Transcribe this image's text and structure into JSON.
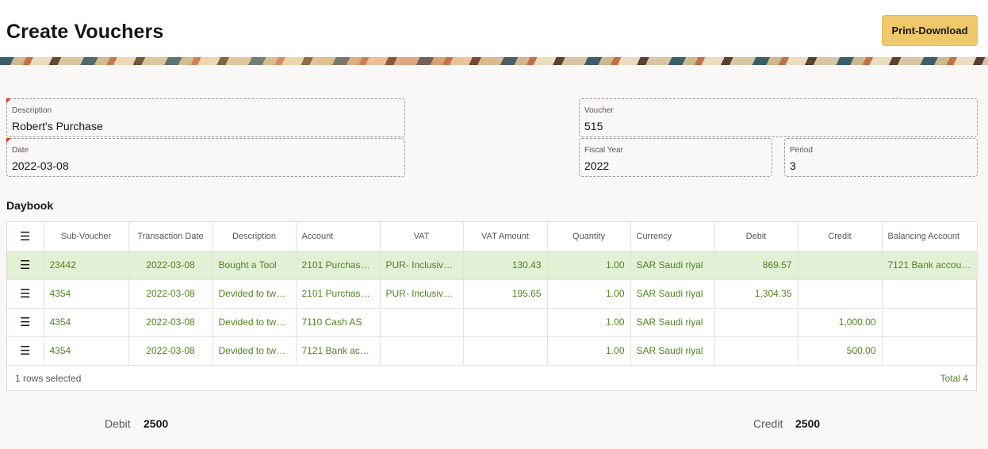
{
  "header": {
    "title": "Create Vouchers",
    "print_label": "Print-Download"
  },
  "form": {
    "description": {
      "label": "Description",
      "value": "Robert's Purchase"
    },
    "date": {
      "label": "Date",
      "value": "2022-03-08"
    },
    "voucher": {
      "label": "Voucher",
      "value": "515"
    },
    "fiscal_year": {
      "label": "Fiscal Year",
      "value": "2022"
    },
    "period": {
      "label": "Period",
      "value": "3"
    }
  },
  "daybook": {
    "title": "Daybook",
    "columns": [
      "Sub-Voucher",
      "Transaction Date",
      "Description",
      "Account",
      "VAT",
      "VAT Amount",
      "Quantity",
      "Currency",
      "Debit",
      "Credit",
      "Balancing Account"
    ],
    "rows": [
      {
        "sub_voucher": "23442",
        "date": "2022-03-08",
        "description": "Bought a Tool",
        "account": "2101 Purchase…",
        "vat": "PUR- Inclusiv…",
        "vat_amount": "130.43",
        "quantity": "1.00",
        "currency": "SAR Saudi riyal",
        "debit": "869.57",
        "credit": "",
        "balancing": "7121 Bank accou…",
        "selected": true
      },
      {
        "sub_voucher": "4354",
        "date": "2022-03-08",
        "description": "Devided to tw…",
        "account": "2101 Purchase…",
        "vat": "PUR- Inclusiv…",
        "vat_amount": "195.65",
        "quantity": "1.00",
        "currency": "SAR Saudi riyal",
        "debit": "1,304.35",
        "credit": "",
        "balancing": "",
        "selected": false
      },
      {
        "sub_voucher": "4354",
        "date": "2022-03-08",
        "description": "Devided to tw…",
        "account": "7110 Cash AS",
        "vat": "",
        "vat_amount": "",
        "quantity": "1.00",
        "currency": "SAR Saudi riyal",
        "debit": "",
        "credit": "1,000.00",
        "balancing": "",
        "selected": false
      },
      {
        "sub_voucher": "4354",
        "date": "2022-03-08",
        "description": "Devided to tw…",
        "account": "7121 Bank acc…",
        "vat": "",
        "vat_amount": "",
        "quantity": "1.00",
        "currency": "SAR Saudi riyal",
        "debit": "",
        "credit": "500.00",
        "balancing": "",
        "selected": false
      }
    ],
    "rows_selected": "1 rows selected",
    "total": "Total 4"
  },
  "totals": {
    "debit_label": "Debit",
    "debit_value": "2500",
    "credit_label": "Credit",
    "credit_value": "2500"
  }
}
